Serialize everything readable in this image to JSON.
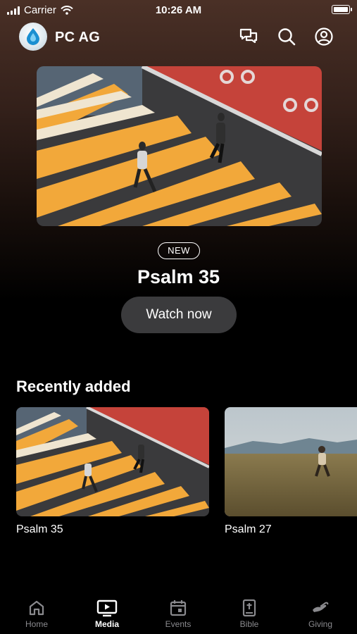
{
  "status_bar": {
    "carrier": "Carrier",
    "time": "10:26 AM"
  },
  "header": {
    "app_name": "PC AG",
    "icons": [
      "chat-icon",
      "search-icon",
      "profile-icon"
    ]
  },
  "hero": {
    "badge": "NEW",
    "title": "Psalm 35",
    "button_label": "Watch now"
  },
  "recently_added": {
    "title": "Recently added",
    "items": [
      {
        "label": "Psalm 35"
      },
      {
        "label": "Psalm 27"
      }
    ]
  },
  "tabs": [
    {
      "label": "Home",
      "icon": "home-icon",
      "active": false
    },
    {
      "label": "Media",
      "icon": "media-icon",
      "active": true
    },
    {
      "label": "Events",
      "icon": "calendar-icon",
      "active": false
    },
    {
      "label": "Bible",
      "icon": "bible-icon",
      "active": false
    },
    {
      "label": "Giving",
      "icon": "giving-icon",
      "active": false
    }
  ],
  "colors": {
    "background": "#000000",
    "button": "#3b3b3d",
    "inactive_tab": "#8a8a8e",
    "hero_tint": "#4a3026"
  }
}
